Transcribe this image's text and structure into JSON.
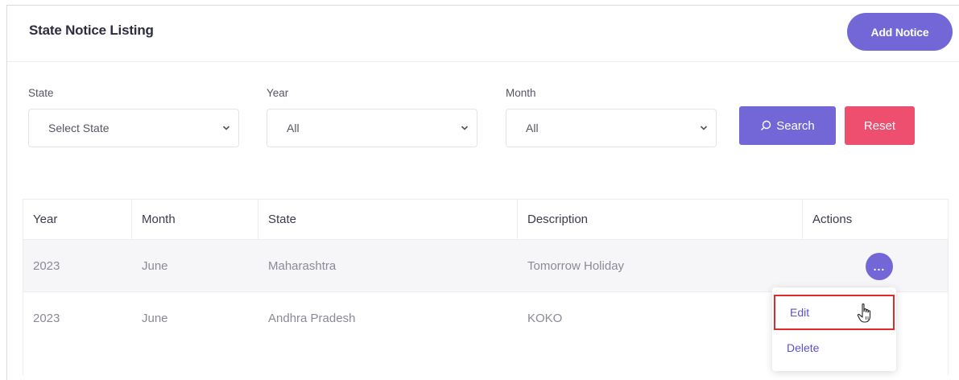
{
  "page": {
    "title": "State Notice Listing",
    "add_button": "Add Notice"
  },
  "filters": {
    "state": {
      "label": "State",
      "value": "Select State"
    },
    "year": {
      "label": "Year",
      "value": "All"
    },
    "month": {
      "label": "Month",
      "value": "All"
    },
    "search_button": "Search",
    "reset_button": "Reset"
  },
  "table": {
    "headers": [
      "Year",
      "Month",
      "State",
      "Description",
      "Actions"
    ],
    "rows": [
      {
        "year": "2023",
        "month": "June",
        "state": "Maharashtra",
        "description": "Tomorrow Holiday"
      },
      {
        "year": "2023",
        "month": "June",
        "state": "Andhra Pradesh",
        "description": "KOKO"
      }
    ]
  },
  "actions_menu": {
    "trigger": "...",
    "edit": "Edit",
    "delete": "Delete"
  },
  "colors": {
    "primary": "#7367d8",
    "danger": "#ef4f6e",
    "highlight": "#e02b2b"
  },
  "icons": [
    "search-icon",
    "chevron-down-icon",
    "more-dots-icon",
    "hand-cursor-icon"
  ]
}
